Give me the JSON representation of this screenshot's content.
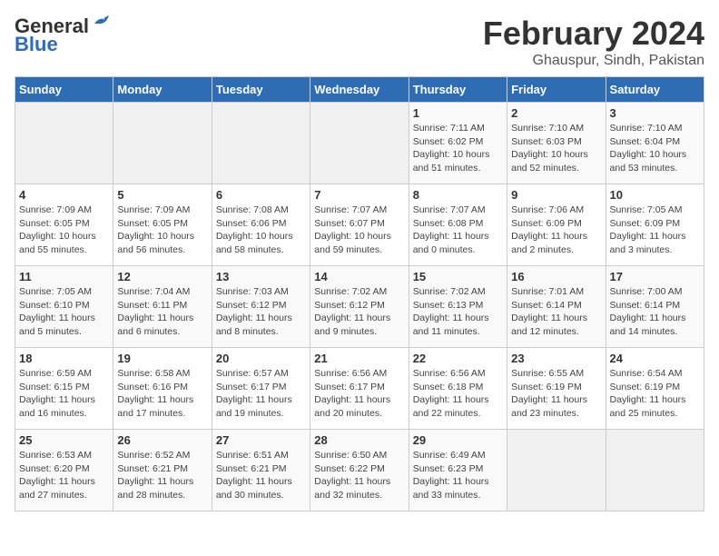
{
  "header": {
    "logo_general": "General",
    "logo_blue": "Blue",
    "month_title": "February 2024",
    "location": "Ghauspur, Sindh, Pakistan"
  },
  "days_of_week": [
    "Sunday",
    "Monday",
    "Tuesday",
    "Wednesday",
    "Thursday",
    "Friday",
    "Saturday"
  ],
  "weeks": [
    [
      {
        "day": "",
        "info": ""
      },
      {
        "day": "",
        "info": ""
      },
      {
        "day": "",
        "info": ""
      },
      {
        "day": "",
        "info": ""
      },
      {
        "day": "1",
        "info": "Sunrise: 7:11 AM\nSunset: 6:02 PM\nDaylight: 10 hours\nand 51 minutes."
      },
      {
        "day": "2",
        "info": "Sunrise: 7:10 AM\nSunset: 6:03 PM\nDaylight: 10 hours\nand 52 minutes."
      },
      {
        "day": "3",
        "info": "Sunrise: 7:10 AM\nSunset: 6:04 PM\nDaylight: 10 hours\nand 53 minutes."
      }
    ],
    [
      {
        "day": "4",
        "info": "Sunrise: 7:09 AM\nSunset: 6:05 PM\nDaylight: 10 hours\nand 55 minutes."
      },
      {
        "day": "5",
        "info": "Sunrise: 7:09 AM\nSunset: 6:05 PM\nDaylight: 10 hours\nand 56 minutes."
      },
      {
        "day": "6",
        "info": "Sunrise: 7:08 AM\nSunset: 6:06 PM\nDaylight: 10 hours\nand 58 minutes."
      },
      {
        "day": "7",
        "info": "Sunrise: 7:07 AM\nSunset: 6:07 PM\nDaylight: 10 hours\nand 59 minutes."
      },
      {
        "day": "8",
        "info": "Sunrise: 7:07 AM\nSunset: 6:08 PM\nDaylight: 11 hours\nand 0 minutes."
      },
      {
        "day": "9",
        "info": "Sunrise: 7:06 AM\nSunset: 6:09 PM\nDaylight: 11 hours\nand 2 minutes."
      },
      {
        "day": "10",
        "info": "Sunrise: 7:05 AM\nSunset: 6:09 PM\nDaylight: 11 hours\nand 3 minutes."
      }
    ],
    [
      {
        "day": "11",
        "info": "Sunrise: 7:05 AM\nSunset: 6:10 PM\nDaylight: 11 hours\nand 5 minutes."
      },
      {
        "day": "12",
        "info": "Sunrise: 7:04 AM\nSunset: 6:11 PM\nDaylight: 11 hours\nand 6 minutes."
      },
      {
        "day": "13",
        "info": "Sunrise: 7:03 AM\nSunset: 6:12 PM\nDaylight: 11 hours\nand 8 minutes."
      },
      {
        "day": "14",
        "info": "Sunrise: 7:02 AM\nSunset: 6:12 PM\nDaylight: 11 hours\nand 9 minutes."
      },
      {
        "day": "15",
        "info": "Sunrise: 7:02 AM\nSunset: 6:13 PM\nDaylight: 11 hours\nand 11 minutes."
      },
      {
        "day": "16",
        "info": "Sunrise: 7:01 AM\nSunset: 6:14 PM\nDaylight: 11 hours\nand 12 minutes."
      },
      {
        "day": "17",
        "info": "Sunrise: 7:00 AM\nSunset: 6:14 PM\nDaylight: 11 hours\nand 14 minutes."
      }
    ],
    [
      {
        "day": "18",
        "info": "Sunrise: 6:59 AM\nSunset: 6:15 PM\nDaylight: 11 hours\nand 16 minutes."
      },
      {
        "day": "19",
        "info": "Sunrise: 6:58 AM\nSunset: 6:16 PM\nDaylight: 11 hours\nand 17 minutes."
      },
      {
        "day": "20",
        "info": "Sunrise: 6:57 AM\nSunset: 6:17 PM\nDaylight: 11 hours\nand 19 minutes."
      },
      {
        "day": "21",
        "info": "Sunrise: 6:56 AM\nSunset: 6:17 PM\nDaylight: 11 hours\nand 20 minutes."
      },
      {
        "day": "22",
        "info": "Sunrise: 6:56 AM\nSunset: 6:18 PM\nDaylight: 11 hours\nand 22 minutes."
      },
      {
        "day": "23",
        "info": "Sunrise: 6:55 AM\nSunset: 6:19 PM\nDaylight: 11 hours\nand 23 minutes."
      },
      {
        "day": "24",
        "info": "Sunrise: 6:54 AM\nSunset: 6:19 PM\nDaylight: 11 hours\nand 25 minutes."
      }
    ],
    [
      {
        "day": "25",
        "info": "Sunrise: 6:53 AM\nSunset: 6:20 PM\nDaylight: 11 hours\nand 27 minutes."
      },
      {
        "day": "26",
        "info": "Sunrise: 6:52 AM\nSunset: 6:21 PM\nDaylight: 11 hours\nand 28 minutes."
      },
      {
        "day": "27",
        "info": "Sunrise: 6:51 AM\nSunset: 6:21 PM\nDaylight: 11 hours\nand 30 minutes."
      },
      {
        "day": "28",
        "info": "Sunrise: 6:50 AM\nSunset: 6:22 PM\nDaylight: 11 hours\nand 32 minutes."
      },
      {
        "day": "29",
        "info": "Sunrise: 6:49 AM\nSunset: 6:23 PM\nDaylight: 11 hours\nand 33 minutes."
      },
      {
        "day": "",
        "info": ""
      },
      {
        "day": "",
        "info": ""
      }
    ]
  ]
}
